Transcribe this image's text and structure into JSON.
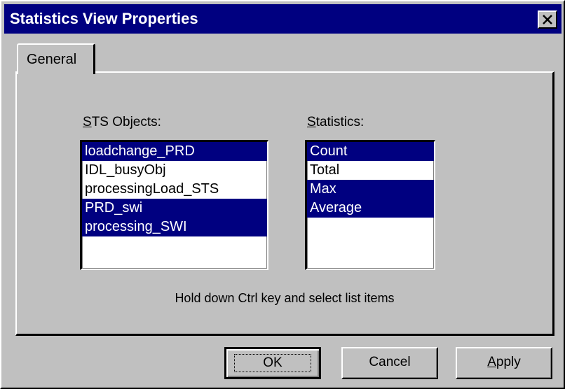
{
  "window": {
    "title": "Statistics View Properties",
    "close_icon": "close-icon"
  },
  "tabs": [
    {
      "label": "General",
      "active": true
    }
  ],
  "sts_objects": {
    "label_prefix": "S",
    "label_rest": "TS Objects:",
    "items": [
      {
        "label": "loadchange_PRD",
        "selected": true
      },
      {
        "label": "IDL_busyObj",
        "selected": false
      },
      {
        "label": "processingLoad_STS",
        "selected": false
      },
      {
        "label": "PRD_swi",
        "selected": true
      },
      {
        "label": "processing_SWI",
        "selected": true
      }
    ]
  },
  "statistics": {
    "label_prefix": "S",
    "label_rest": "tatistics:",
    "items": [
      {
        "label": "Count",
        "selected": true
      },
      {
        "label": "Total",
        "selected": false
      },
      {
        "label": "Max",
        "selected": true
      },
      {
        "label": "Average",
        "selected": true
      }
    ]
  },
  "hint": "Hold down Ctrl key and select list items",
  "buttons": {
    "ok": "OK",
    "cancel": "Cancel",
    "apply_prefix": "A",
    "apply_rest": "pply"
  },
  "colors": {
    "titlebar": "#000080",
    "selection": "#000080",
    "face": "#c0c0c0"
  }
}
